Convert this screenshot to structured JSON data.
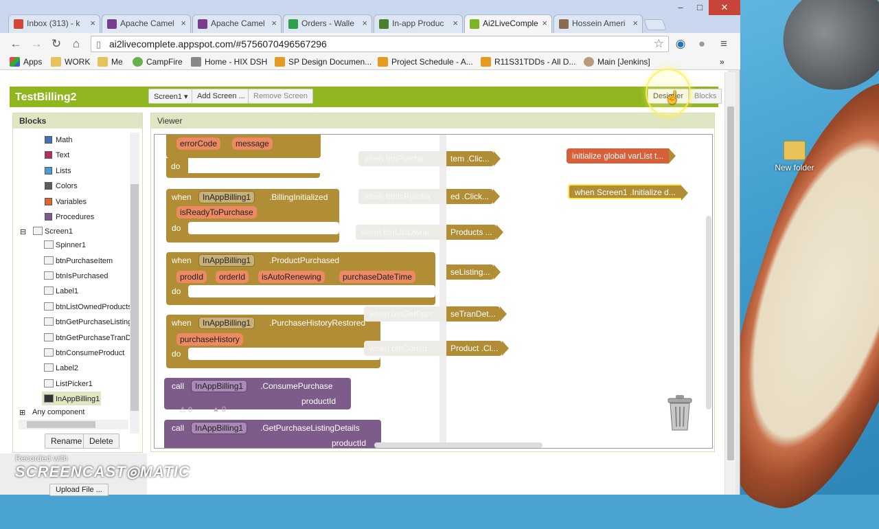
{
  "browser": {
    "tabs": [
      {
        "title": "Inbox (313) - k",
        "color": "#d44638"
      },
      {
        "title": "Apache Camel",
        "color": "#7a3c8c"
      },
      {
        "title": "Apache Camel",
        "color": "#7a3c8c"
      },
      {
        "title": "Orders - Walle",
        "color": "#2f9e4f"
      },
      {
        "title": "In-app Produc",
        "color": "#4b7f2c"
      },
      {
        "title": "Ai2LiveComple",
        "color": "#7fb22b"
      },
      {
        "title": "Hossein Ameri",
        "color": "#8a6a50"
      }
    ],
    "url": "ai2livecomplete.appspot.com/#5756070496567296",
    "bookmarks": [
      "Apps",
      "WORK",
      "Me",
      "CampFire",
      "Home - HIX DSH",
      "SP Design Documen...",
      "Project Schedule - A...",
      "R11S31TDDs - All D...",
      "Main [Jenkins]"
    ],
    "more": "»"
  },
  "app": {
    "project_name": "TestBilling2",
    "screen_selector": "Screen1 ▾",
    "add_screen": "Add Screen ...",
    "remove_screen": "Remove Screen",
    "designer": "Designer",
    "blocks": "Blocks"
  },
  "blocks_panel": {
    "title": "Blocks",
    "builtins": [
      {
        "label": "Math",
        "color": "#3f71b5"
      },
      {
        "label": "Text",
        "color": "#b32d5e"
      },
      {
        "label": "Lists",
        "color": "#4d9bd6"
      },
      {
        "label": "Colors",
        "color": "#5e5e5e"
      },
      {
        "label": "Variables",
        "color": "#e2612f"
      },
      {
        "label": "Procedures",
        "color": "#7d5c8c"
      }
    ],
    "screen": "Screen1",
    "components": [
      "Spinner1",
      "btnPurchaseItem",
      "btnIsPurchased",
      "Label1",
      "btnListOwnedProducts",
      "btnGetPurchaseListing",
      "btnGetPurchaseTranD",
      "btnConsumeProduct",
      "Label2",
      "ListPicker1",
      "InAppBilling1"
    ],
    "any_component": "Any component",
    "rename": "Rename",
    "delete": "Delete",
    "upload": "Upload File ..."
  },
  "viewer": {
    "title": "Viewer",
    "blocks": {
      "billing_error": {
        "params": [
          "errorCode",
          "message"
        ],
        "do": "do"
      },
      "billing_initialized": {
        "when": "when",
        "component": "InAppBilling1",
        "event": ".BillingInitialized",
        "params": [
          "isReadyToPurchase"
        ],
        "do": "do"
      },
      "product_purchased": {
        "when": "when",
        "component": "InAppBilling1",
        "event": ".ProductPurchased",
        "params": [
          "prodId",
          "orderId",
          "isAutoRenewing",
          "purchaseDateTime"
        ],
        "do": "do"
      },
      "history_restored": {
        "when": "when",
        "component": "InAppBilling1",
        "event": ".PurchaseHistoryRestored",
        "params": [
          "purchaseHistory"
        ],
        "do": "do"
      },
      "consume": {
        "call": "call",
        "component": "InAppBilling1",
        "method": ".ConsumePurchase",
        "arg": "productId"
      },
      "listing_details": {
        "call": "call",
        "component": "InAppBilling1",
        "method": ".GetPurchaseListingDetails",
        "arg": "productId"
      }
    },
    "collapsed": [
      {
        "ghost": "when  btnPurcha",
        "tail": "tem .Clic..."
      },
      {
        "ghost": "when  btnIsPurcha",
        "tail": "ed .Click..."
      },
      {
        "ghost": "when  btnListOwne",
        "tail": "Products ..."
      },
      {
        "ghost": "",
        "tail": "seListing..."
      },
      {
        "ghost": "when  btnGetPurc",
        "tail": "seTranDet..."
      },
      {
        "ghost": "when  btnConsu",
        "tail": "Product .Cl..."
      }
    ],
    "global_var": "initialize global varList t...",
    "screen_init": "when  Screen1 .Initialize d...",
    "warnings": "0",
    "errors": "0"
  },
  "desktop": {
    "folder": "New folder"
  },
  "watermark": {
    "recorded": "Recorded with",
    "brand": "SCREENCAST◎MATIC"
  }
}
